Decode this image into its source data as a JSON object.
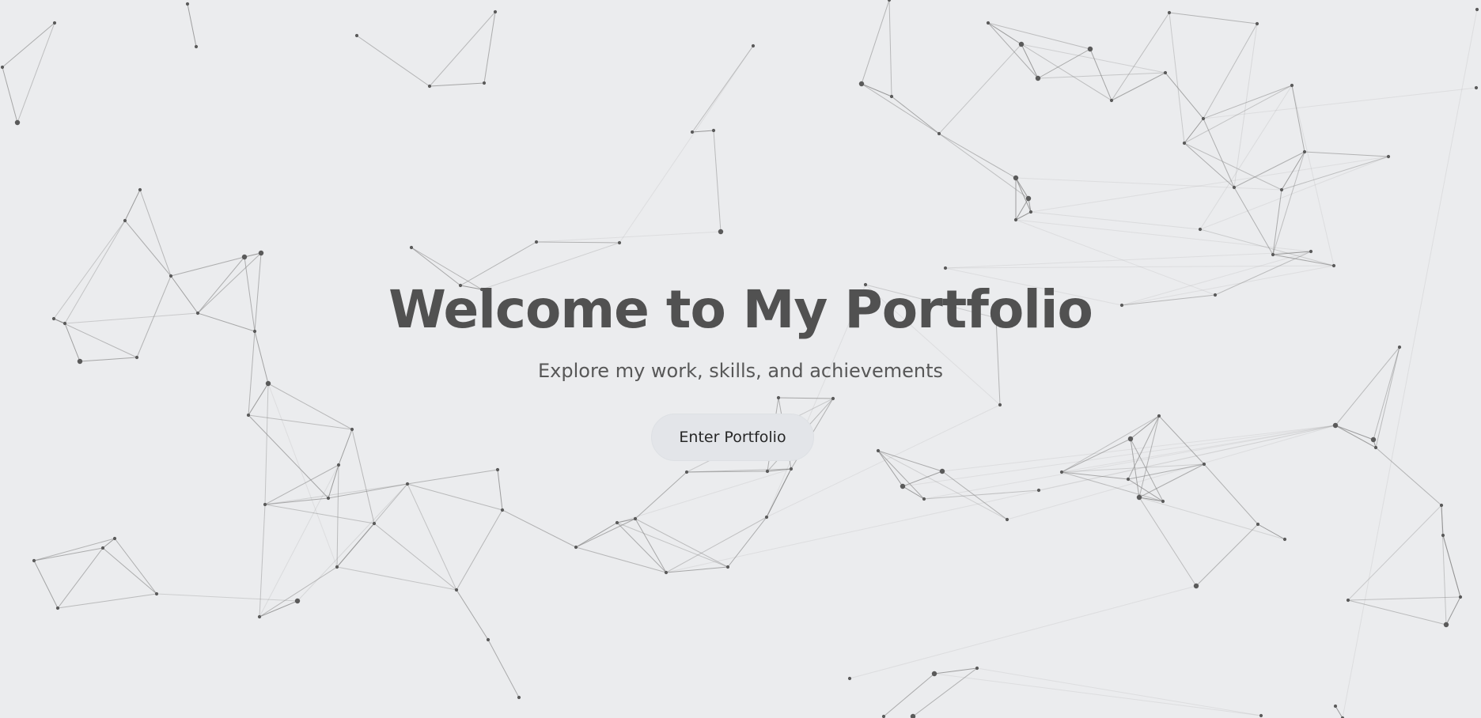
{
  "hero": {
    "title": "Welcome to My Portfolio",
    "subtitle": "Explore my work, skills, and achievements",
    "button_label": "Enter Portfolio"
  },
  "colors": {
    "background": "#ebecee",
    "node": "#5a5a5a",
    "link": "#8a8a8a",
    "title": "#515151",
    "button_background": "#e3e5e9"
  },
  "background": {
    "type": "particle-network"
  }
}
